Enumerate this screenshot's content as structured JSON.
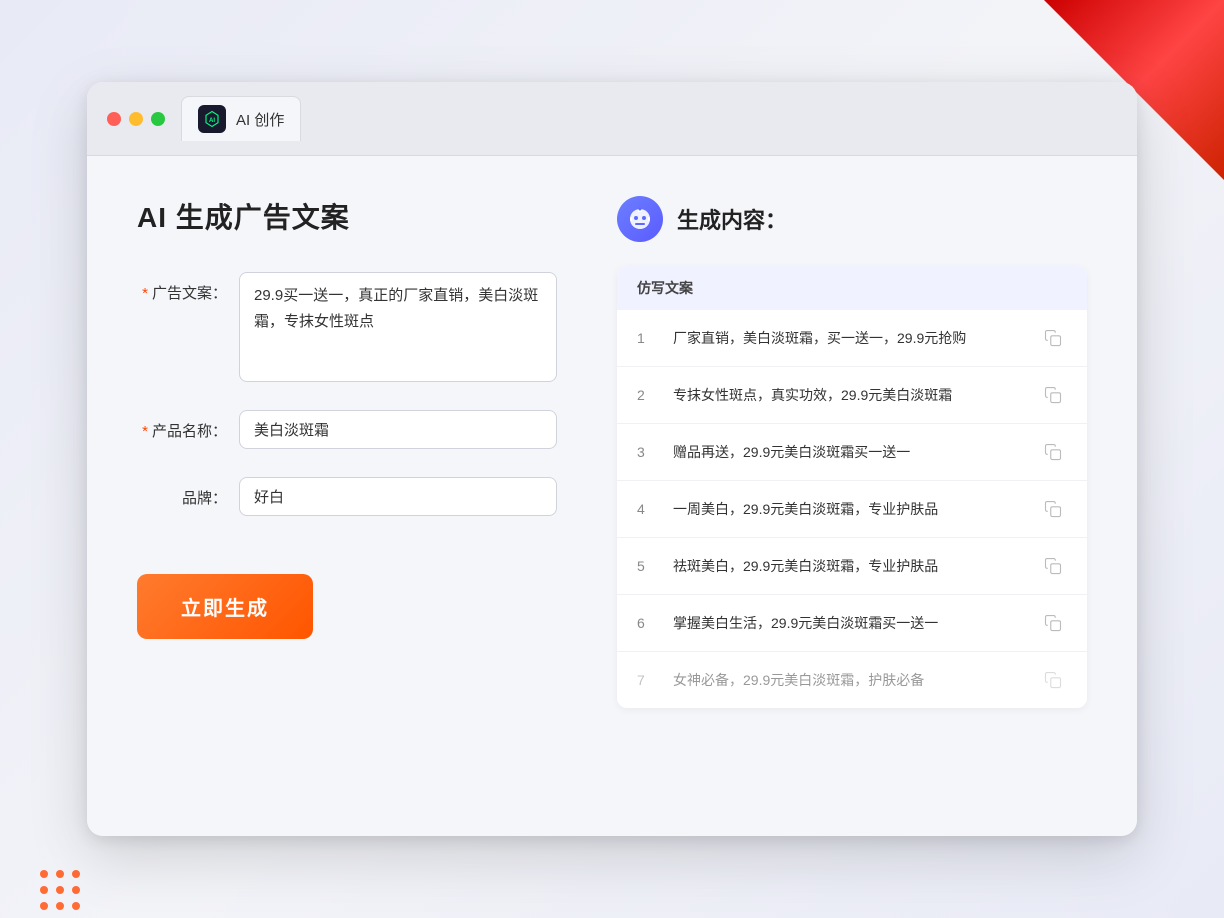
{
  "browser": {
    "tab_title": "AI 创作"
  },
  "page": {
    "title": "AI 生成广告文案"
  },
  "form": {
    "ad_copy_label": "广告文案：",
    "ad_copy_required": "*",
    "ad_copy_value": "29.9买一送一，真正的厂家直销，美白淡斑霜，专抹女性斑点",
    "product_name_label": "产品名称：",
    "product_name_required": "*",
    "product_name_value": "美白淡斑霜",
    "brand_label": "品牌：",
    "brand_value": "好白",
    "generate_button_label": "立即生成"
  },
  "results": {
    "header_label": "生成内容：",
    "column_header": "仿写文案",
    "items": [
      {
        "number": "1",
        "text": "厂家直销，美白淡斑霜，买一送一，29.9元抢购"
      },
      {
        "number": "2",
        "text": "专抹女性斑点，真实功效，29.9元美白淡斑霜"
      },
      {
        "number": "3",
        "text": "赠品再送，29.9元美白淡斑霜买一送一"
      },
      {
        "number": "4",
        "text": "一周美白，29.9元美白淡斑霜，专业护肤品"
      },
      {
        "number": "5",
        "text": "祛斑美白，29.9元美白淡斑霜，专业护肤品"
      },
      {
        "number": "6",
        "text": "掌握美白生活，29.9元美白淡斑霜买一送一"
      },
      {
        "number": "7",
        "text": "女神必备，29.9元美白淡斑霜，护肤必备"
      }
    ]
  }
}
